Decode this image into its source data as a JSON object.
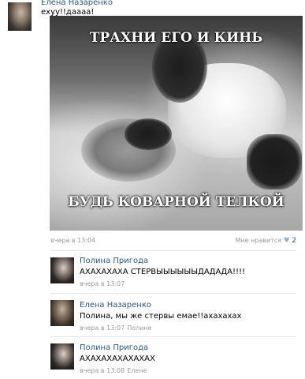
{
  "post": {
    "author": "Елена Назаренко",
    "text": "ехуу!!даааа!",
    "image": {
      "caption_top": "ТРАХНИ ЕГО И КИНЬ",
      "caption_bottom": "БУДЬ КОВАРНОЙ ТЕЛКОЙ"
    },
    "date": "вчера в 13:04",
    "like_label": "Мне нравится",
    "like_count": "2"
  },
  "comments": [
    {
      "author": "Полина Пригода",
      "text": "АХАХАХАХА СТЕРВЫЫЫЫЫЫДАДАДА!!!!",
      "date": "вчера в 13:07",
      "reply_to": ""
    },
    {
      "author": "Елена Назаренко",
      "text": "Полина, мы же стервы емае!!ахахахах",
      "date": "вчера в 13:07",
      "reply_to": "Полине"
    },
    {
      "author": "Полина Пригода",
      "text": "АХАХАХАХАХАХАХ",
      "date": "вчера в 13:08",
      "reply_to": "Елене"
    }
  ],
  "colors": {
    "link": "#2b587a",
    "meta": "#999999",
    "divider": "#e7eaed"
  }
}
